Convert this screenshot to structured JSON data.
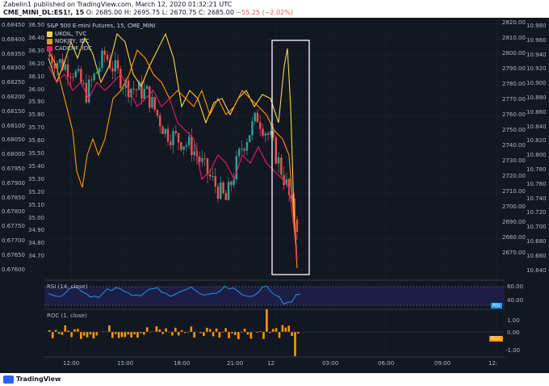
{
  "header": {
    "publisher_line": "Zabelin1 published on TradingView.com, March 12, 2020 01:32:21 UTC",
    "symbol": "CME_MINI_DL:ES1!, 15",
    "o": "O: 2685.00",
    "h": "H: 2695.75",
    "l": "L: 2670.75",
    "c": "C: 2685.00",
    "change": "−55.25 (−2.02%)"
  },
  "legend": {
    "title": "S&P 500 E-mini Futures, 15, CME_MINI",
    "items": [
      {
        "label": "UKOIL, TVC",
        "color": "#f7d54a"
      },
      {
        "label": "NOKJPY, IDC",
        "color": "#ff9800"
      },
      {
        "label": "CADCHF, IDC",
        "color": "#e91e63"
      }
    ]
  },
  "axes": {
    "left_outer": [
      "0.68450",
      "0.68400",
      "0.68350",
      "0.68300",
      "0.68250",
      "0.68200",
      "0.68150",
      "0.68100",
      "0.68050",
      "0.68000",
      "0.67950",
      "0.67900",
      "0.67850",
      "0.67800",
      "0.67750",
      "0.67700",
      "0.67650",
      "0.67600"
    ],
    "left_inner": [
      "36.50",
      "36.40",
      "36.30",
      "36.20",
      "36.10",
      "36.00",
      "35.90",
      "35.80",
      "35.70",
      "35.60",
      "35.50",
      "35.40",
      "35.30",
      "35.20",
      "35.10",
      "35.00",
      "34.90",
      "34.80",
      "34.70"
    ],
    "right_es": [
      "2820.00",
      "2810.00",
      "2800.00",
      "2790.00",
      "2780.00",
      "2770.00",
      "2760.00",
      "2750.00",
      "2740.00",
      "2730.00",
      "2720.00",
      "2710.00",
      "2700.00",
      "2690.00",
      "2680.00",
      "2670.00"
    ],
    "right_outer": [
      "10.980",
      "10.960",
      "10.940",
      "10.920",
      "10.900",
      "10.880",
      "10.860",
      "10.840",
      "10.820",
      "10.800",
      "10.780",
      "10.760",
      "10.740",
      "10.720",
      "10.700",
      "10.680",
      "10.660",
      "10.640"
    ],
    "time": [
      "12:00",
      "15:00",
      "18:00",
      "21:00",
      "12",
      "03:00",
      "06:00",
      "09:00",
      "12:"
    ],
    "time_x": [
      88,
      155,
      225,
      291,
      341,
      409,
      478,
      548,
      615
    ]
  },
  "rsi": {
    "label": "RSI (14, close)",
    "ticks": [
      "60.00",
      "40.00"
    ],
    "badge": "RSI",
    "color": "#2196f3"
  },
  "roc": {
    "label": "ROC (1, close)",
    "ticks": [
      "1.00",
      "0.00",
      "-1.00"
    ],
    "badge": "ROC",
    "color": "#ff9800"
  },
  "footer": {
    "brand": "TradingView"
  },
  "colors": {
    "up": "#26a69a",
    "down": "#ef5350",
    "bg": "#131722"
  }
}
